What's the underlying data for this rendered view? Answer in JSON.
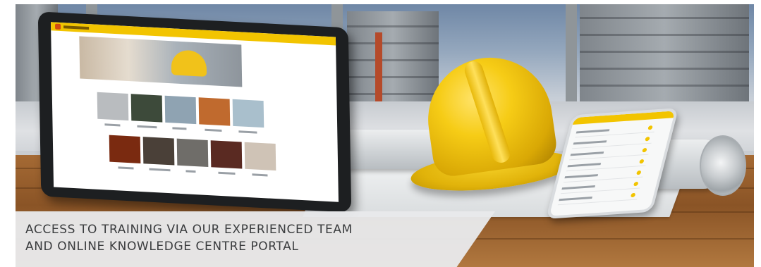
{
  "caption": {
    "line1": "ACCESS TO TRAINING VIA OUR EXPERIENCED TEAM",
    "line2": "AND ONLINE KNOWLEDGE CENTRE PORTAL"
  },
  "colors": {
    "accent_yellow": "#f2c400",
    "caption_background": "#e8e9eb",
    "caption_text": "#3a3c3e"
  },
  "illustration": {
    "subjects": [
      "tablet",
      "hard-hat",
      "smartphone",
      "blueprint-rolls",
      "construction-site-background"
    ]
  }
}
